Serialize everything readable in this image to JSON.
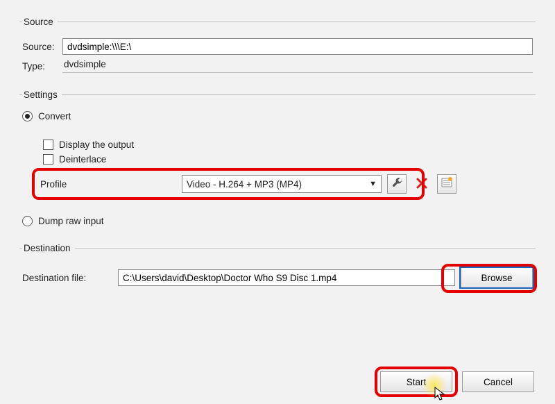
{
  "source_group": {
    "legend": "Source",
    "source_label": "Source:",
    "source_value": "dvdsimple:\\\\\\E:\\",
    "type_label": "Type:",
    "type_value": "dvdsimple"
  },
  "settings_group": {
    "legend": "Settings",
    "convert_radio": {
      "label": "Convert",
      "checked": true
    },
    "display_output_check": {
      "label": "Display the output",
      "checked": false
    },
    "deinterlace_check": {
      "label": "Deinterlace",
      "checked": false
    },
    "profile": {
      "label": "Profile",
      "selected": "Video - H.264 + MP3 (MP4)"
    },
    "dump_raw_radio": {
      "label": "Dump raw input",
      "checked": false
    }
  },
  "destination_group": {
    "legend": "Destination",
    "dest_file_label": "Destination file:",
    "dest_file_value": "C:\\Users\\david\\Desktop\\Doctor Who S9 Disc 1.mp4",
    "browse_label": "Browse"
  },
  "actions": {
    "start": "Start",
    "cancel": "Cancel"
  },
  "icons": {
    "wrench": "wrench-icon",
    "delete": "delete-x-icon",
    "list": "list-icon",
    "dropdown": "chevron-down-icon"
  }
}
